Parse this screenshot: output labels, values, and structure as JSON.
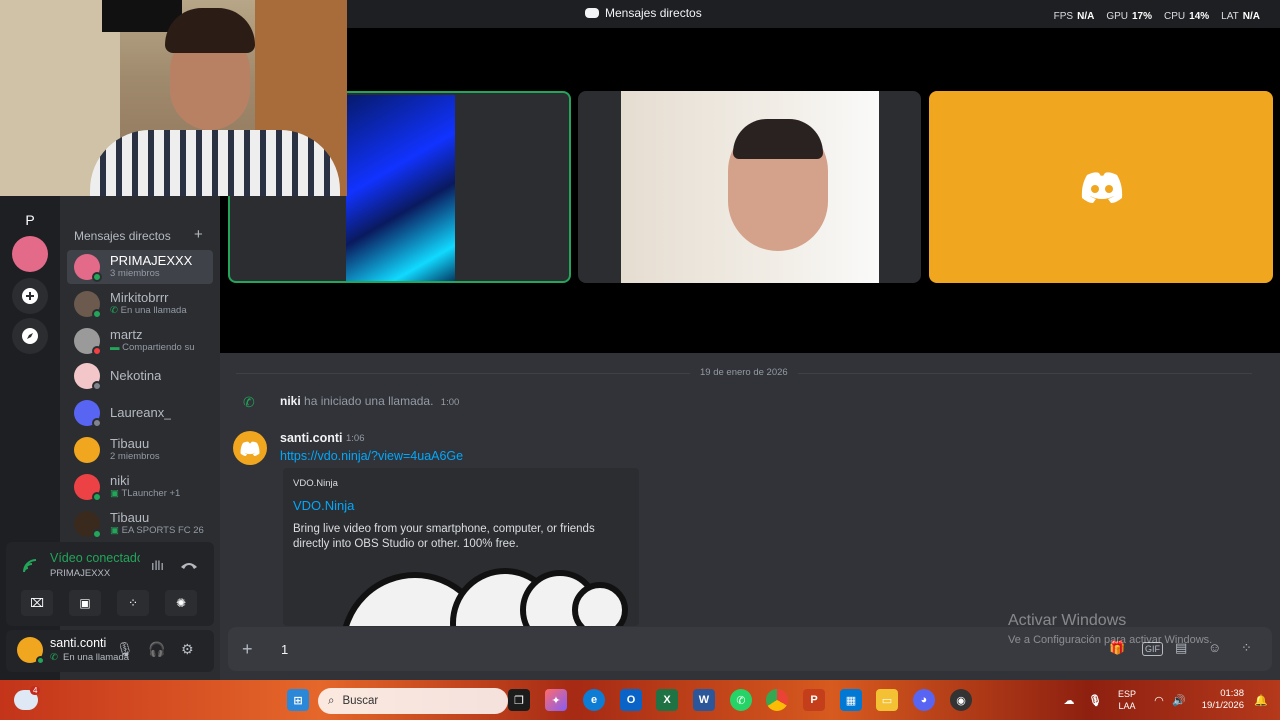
{
  "titlebar": {
    "title": "Mensajes directos"
  },
  "stats": [
    {
      "label": "FPS",
      "value": "N/A"
    },
    {
      "label": "GPU",
      "value": "17%"
    },
    {
      "label": "CPU",
      "value": "14%"
    },
    {
      "label": "LAT",
      "value": "N/A"
    }
  ],
  "rail": {
    "home_letter": "P"
  },
  "dms": {
    "header": "Mensajes directos",
    "add": "+",
    "items": [
      {
        "name": "PRIMAJEXXX",
        "sub": "3 miembros",
        "color": "#e46a8a"
      },
      {
        "name": "Mirkitobrrr",
        "sub": "En una llamada",
        "color": "#6b5a4d"
      },
      {
        "name": "martz",
        "sub": "Compartiendo su",
        "color": "#9a9a9a"
      },
      {
        "name": "Nekotina",
        "sub": "",
        "color": "#f3c7c9"
      },
      {
        "name": "Laureanx_",
        "sub": "",
        "color": "#5865f2"
      },
      {
        "name": "Tibauu",
        "sub": "2 miembros",
        "color": "#f0a61f"
      },
      {
        "name": "niki",
        "sub": "TLauncher +1",
        "color": "#ed4245"
      },
      {
        "name": "Tibauu",
        "sub": "EA SPORTS FC 26",
        "color": "#3a2a1e"
      }
    ]
  },
  "voice": {
    "status": "Vídeo conectado",
    "channel": "PRIMAJEXXX"
  },
  "user": {
    "name": "santi.conti",
    "status": "En una llamada"
  },
  "chat": {
    "date": "19 de enero de 2026",
    "call_user": "niki",
    "call_text": "ha iniciado una llamada.",
    "call_time": "1:00",
    "author": "santi.conti",
    "time": "1:06",
    "link": "https://vdo.ninja/?view=4uaA6Ge",
    "embed": {
      "provider": "VDO.Ninja",
      "title": "VDO.Ninja",
      "description": "Bring live video from your smartphone, computer, or friends directly into OBS Studio or other. 100% free."
    },
    "composer_text": "1",
    "plus": "+"
  },
  "watermark": {
    "line1": "Activar Windows",
    "line2": "Ve a Configuración para activar Windows."
  },
  "taskbar": {
    "search_placeholder": "Buscar",
    "lang1": "ESP",
    "lang2": "LAA",
    "time": "01:38",
    "date": "19/1/2026",
    "notif_badge": "4"
  }
}
